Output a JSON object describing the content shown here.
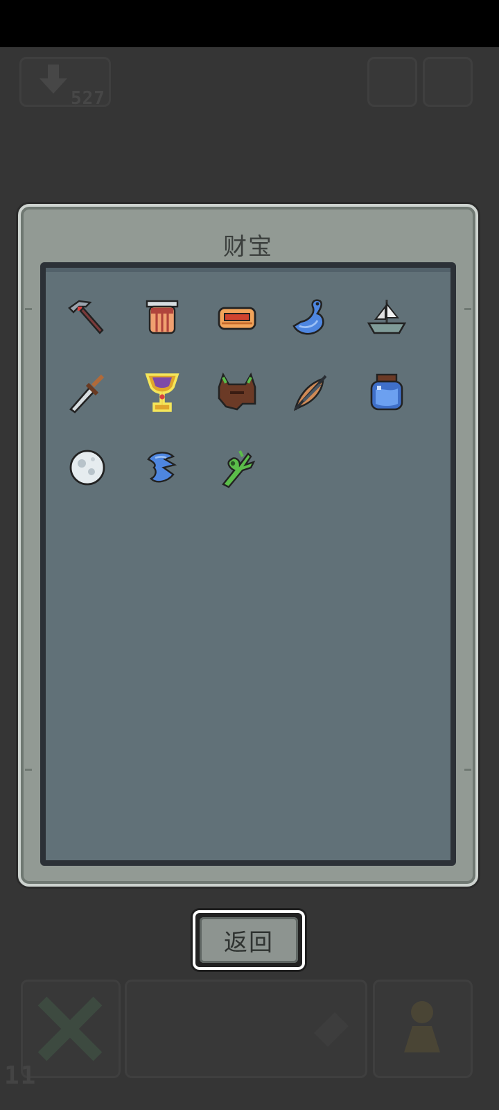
{
  "panel": {
    "title": "财宝"
  },
  "background_hud": {
    "counter": "527",
    "level": "11"
  },
  "treasures": [
    {
      "name": "pickaxe"
    },
    {
      "name": "striped-urn"
    },
    {
      "name": "treasure-chest"
    },
    {
      "name": "blue-serpent"
    },
    {
      "name": "sailing-ship"
    },
    {
      "name": "short-sword"
    },
    {
      "name": "golden-chalice"
    },
    {
      "name": "horned-helmet"
    },
    {
      "name": "feather-quill"
    },
    {
      "name": "water-jar"
    },
    {
      "name": "moon-orb"
    },
    {
      "name": "blue-claw"
    },
    {
      "name": "green-sprout-key"
    }
  ],
  "buttons": {
    "return_label": "返回"
  },
  "colors": {
    "panel_bg": "#929a94",
    "panel_inner_bg": "#617178",
    "highlight_selected": "#f4e65a"
  }
}
